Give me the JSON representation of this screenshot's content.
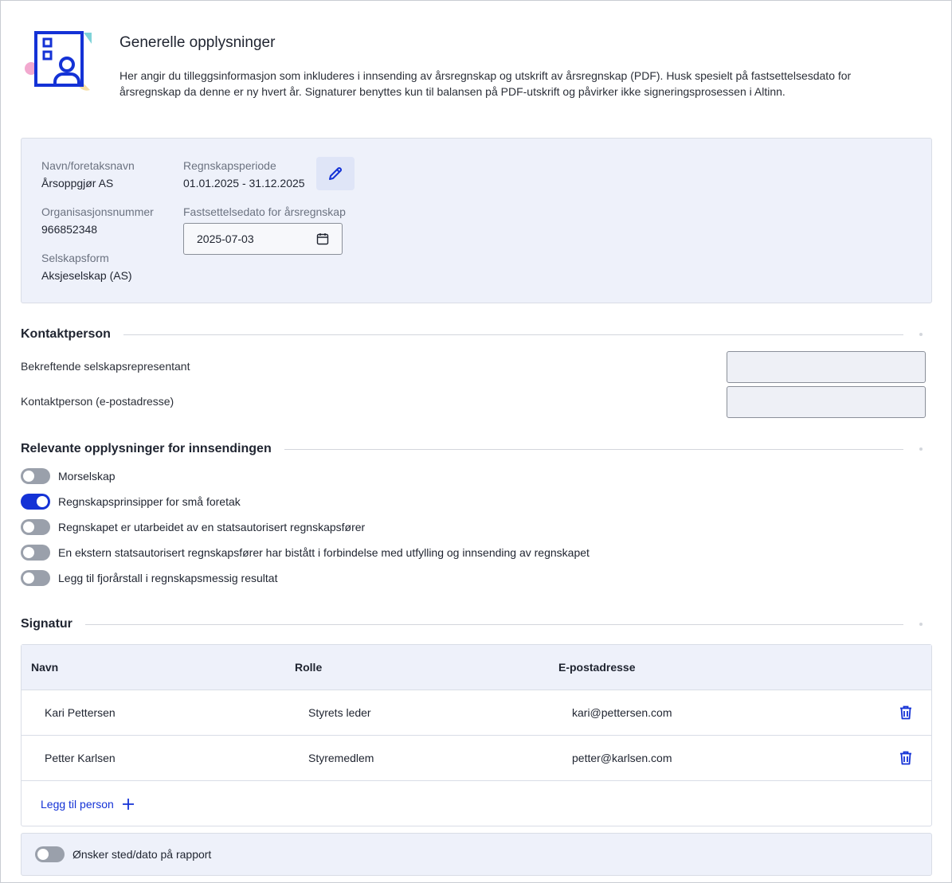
{
  "colors": {
    "accent": "#1432d6",
    "panel_bg": "#eef1fa",
    "toggle_off": "#9aa0ab"
  },
  "header": {
    "title": "Generelle opplysninger",
    "description": "Her angir du tilleggsinformasjon som inkluderes i innsending av årsregnskap og utskrift av årsregnskap (PDF). Husk spesielt på fastsettelsesdato for årsregnskap da denne er ny hvert år. Signaturer benyttes kun til balansen på PDF-utskrift og påvirker ikke signeringsprosessen i Altinn."
  },
  "company": {
    "name_label": "Navn/foretaksnavn",
    "name_value": "Årsoppgjør AS",
    "org_label": "Organisasjonsnummer",
    "org_value": "966852348",
    "form_label": "Selskapsform",
    "form_value": "Aksjeselskap (AS)",
    "period_label": "Regnskapsperiode",
    "period_value": "01.01.2025 - 31.12.2025",
    "date_label": "Fastsettelsedato for årsregnskap",
    "date_value": "2025-07-03",
    "edit_icon": "pencil-icon",
    "calendar_icon": "calendar-icon"
  },
  "contact": {
    "title": "Kontaktperson",
    "rep_label": "Bekreftende selskapsrepresentant",
    "rep_value": "",
    "email_label": "Kontaktperson (e-postadresse)",
    "email_value": ""
  },
  "relevant": {
    "title": "Relevante opplysninger for innsendingen",
    "toggles": [
      {
        "label": "Morselskap",
        "on": false
      },
      {
        "label": "Regnskapsprinsipper for små foretak",
        "on": true
      },
      {
        "label": "Regnskapet er utarbeidet av en statsautorisert regnskapsfører",
        "on": false
      },
      {
        "label": "En ekstern statsautorisert regnskapsfører har bistått i forbindelse med utfylling og innsending av regnskapet",
        "on": false
      },
      {
        "label": "Legg til fjorårstall i regnskapsmessig resultat",
        "on": false
      }
    ]
  },
  "signature": {
    "title": "Signatur",
    "columns": [
      "Navn",
      "Rolle",
      "E-postadresse"
    ],
    "rows": [
      {
        "name": "Kari Pettersen",
        "role": "Styrets leder",
        "email": "kari@pettersen.com"
      },
      {
        "name": "Petter Karlsen",
        "role": "Styremedlem",
        "email": "petter@karlsen.com"
      }
    ],
    "add_label": "Legg til person",
    "delete_icon": "trash-icon",
    "add_icon": "plus-icon"
  },
  "report": {
    "label": "Ønsker sted/dato på rapport",
    "on": false
  }
}
